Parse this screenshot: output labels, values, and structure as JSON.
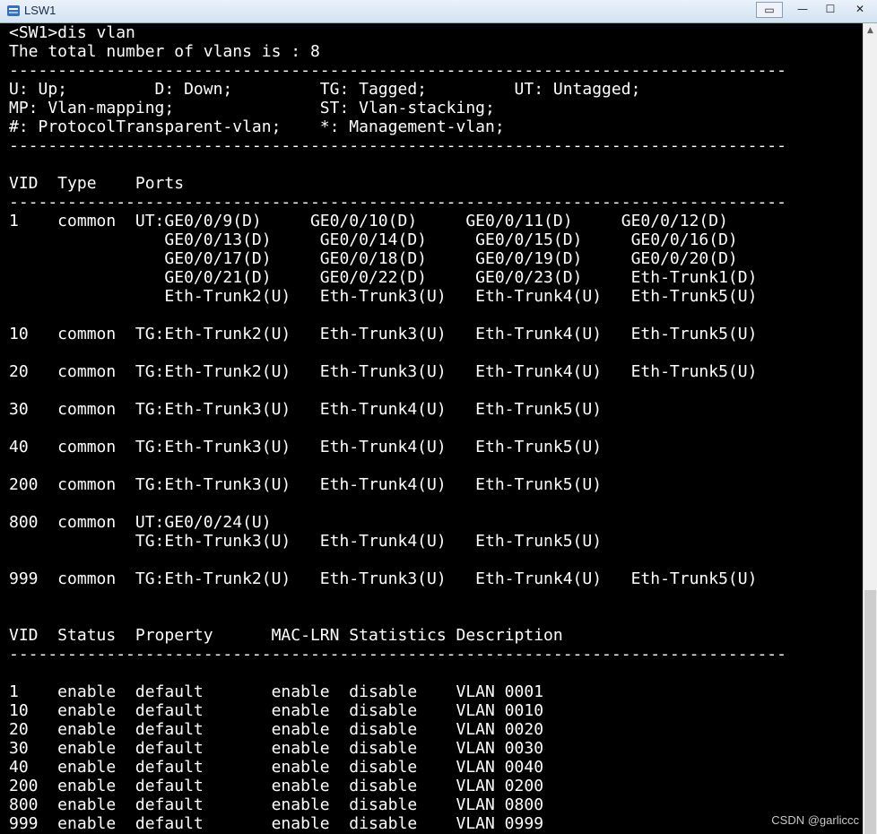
{
  "window": {
    "title": "LSW1",
    "buttons": {
      "restore_alt": "▭",
      "minimize": "—",
      "maximize": "☐",
      "close": "✕"
    }
  },
  "terminal": {
    "lines": [
      "<SW1>dis vlan",
      "The total number of vlans is : 8",
      "--------------------------------------------------------------------------------",
      "U: Up;         D: Down;         TG: Tagged;         UT: Untagged;",
      "MP: Vlan-mapping;               ST: Vlan-stacking;",
      "#: ProtocolTransparent-vlan;    *: Management-vlan;",
      "--------------------------------------------------------------------------------",
      "",
      "VID  Type    Ports",
      "--------------------------------------------------------------------------------",
      "1    common  UT:GE0/0/9(D)     GE0/0/10(D)     GE0/0/11(D)     GE0/0/12(D)",
      "                GE0/0/13(D)     GE0/0/14(D)     GE0/0/15(D)     GE0/0/16(D)",
      "                GE0/0/17(D)     GE0/0/18(D)     GE0/0/19(D)     GE0/0/20(D)",
      "                GE0/0/21(D)     GE0/0/22(D)     GE0/0/23(D)     Eth-Trunk1(D)",
      "                Eth-Trunk2(U)   Eth-Trunk3(U)   Eth-Trunk4(U)   Eth-Trunk5(U)",
      "",
      "10   common  TG:Eth-Trunk2(U)   Eth-Trunk3(U)   Eth-Trunk4(U)   Eth-Trunk5(U)",
      "",
      "20   common  TG:Eth-Trunk2(U)   Eth-Trunk3(U)   Eth-Trunk4(U)   Eth-Trunk5(U)",
      "",
      "30   common  TG:Eth-Trunk3(U)   Eth-Trunk4(U)   Eth-Trunk5(U)",
      "",
      "40   common  TG:Eth-Trunk3(U)   Eth-Trunk4(U)   Eth-Trunk5(U)",
      "",
      "200  common  TG:Eth-Trunk3(U)   Eth-Trunk4(U)   Eth-Trunk5(U)",
      "",
      "800  common  UT:GE0/0/24(U)",
      "             TG:Eth-Trunk3(U)   Eth-Trunk4(U)   Eth-Trunk5(U)",
      "",
      "999  common  TG:Eth-Trunk2(U)   Eth-Trunk3(U)   Eth-Trunk4(U)   Eth-Trunk5(U)",
      "",
      "",
      "VID  Status  Property      MAC-LRN Statistics Description",
      "--------------------------------------------------------------------------------",
      "",
      "1    enable  default       enable  disable    VLAN 0001",
      "10   enable  default       enable  disable    VLAN 0010",
      "20   enable  default       enable  disable    VLAN 0020",
      "30   enable  default       enable  disable    VLAN 0030",
      "40   enable  default       enable  disable    VLAN 0040",
      "200  enable  default       enable  disable    VLAN 0200",
      "800  enable  default       enable  disable    VLAN 0800",
      "999  enable  default       enable  disable    VLAN 0999"
    ]
  },
  "scrollbar": {
    "up_arrow": "▲",
    "position_fraction": 1.0
  },
  "watermark": "CSDN @garliccc",
  "colors": {
    "terminal_bg": "#000000",
    "terminal_fg": "#ffffff",
    "titlebar": "#d3e3f3"
  }
}
